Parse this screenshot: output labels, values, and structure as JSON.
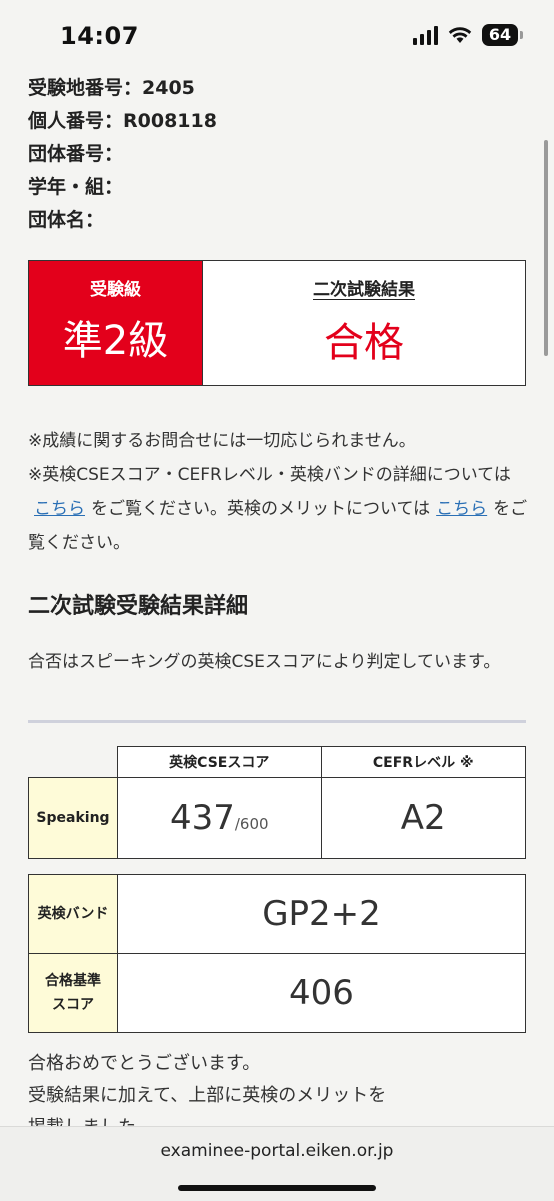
{
  "status_bar": {
    "time": "14:07",
    "battery": "64"
  },
  "info": [
    {
      "label": "受験地番号：",
      "value": "2405"
    },
    {
      "label": "個人番号：",
      "value": "R008118"
    },
    {
      "label": "団体番号：",
      "value": ""
    },
    {
      "label": "学年・組：",
      "value": ""
    },
    {
      "label": "団体名：",
      "value": ""
    }
  ],
  "grade": {
    "label": "受験級",
    "value": "準2級"
  },
  "result": {
    "label": "二次試験結果",
    "value": "合格"
  },
  "notes": {
    "line1": "※成績に関するお問合せには一切応じられません。",
    "line2_a": "※英検CSEスコア・CEFRレベル・英検バンドの詳細については",
    "link1": "こちら",
    "line2_b": "をご覧ください。英検のメリットについては",
    "link2": "こちら",
    "line2_c": "をご覧ください。"
  },
  "section": {
    "title": "二次試験受験結果詳細",
    "description": "合否はスピーキングの英検CSEスコアにより判定しています。"
  },
  "score_table": {
    "col1": "英検CSEスコア",
    "col2": "CEFRレベル ※",
    "row_label": "Speaking",
    "score": "437",
    "score_max": "/600",
    "cefr": "A2"
  },
  "band_table": {
    "band_label": "英検バンド",
    "band_value": "GP2+2",
    "pass_label_1": "合格基準",
    "pass_label_2": "スコア",
    "pass_value": "406"
  },
  "congrats": {
    "line1": "合格おめでとうございます。",
    "line2": "受験結果に加えて、上部に英検のメリットを",
    "line3": "掲載しました。"
  },
  "url": "examinee-portal.eiken.or.jp"
}
